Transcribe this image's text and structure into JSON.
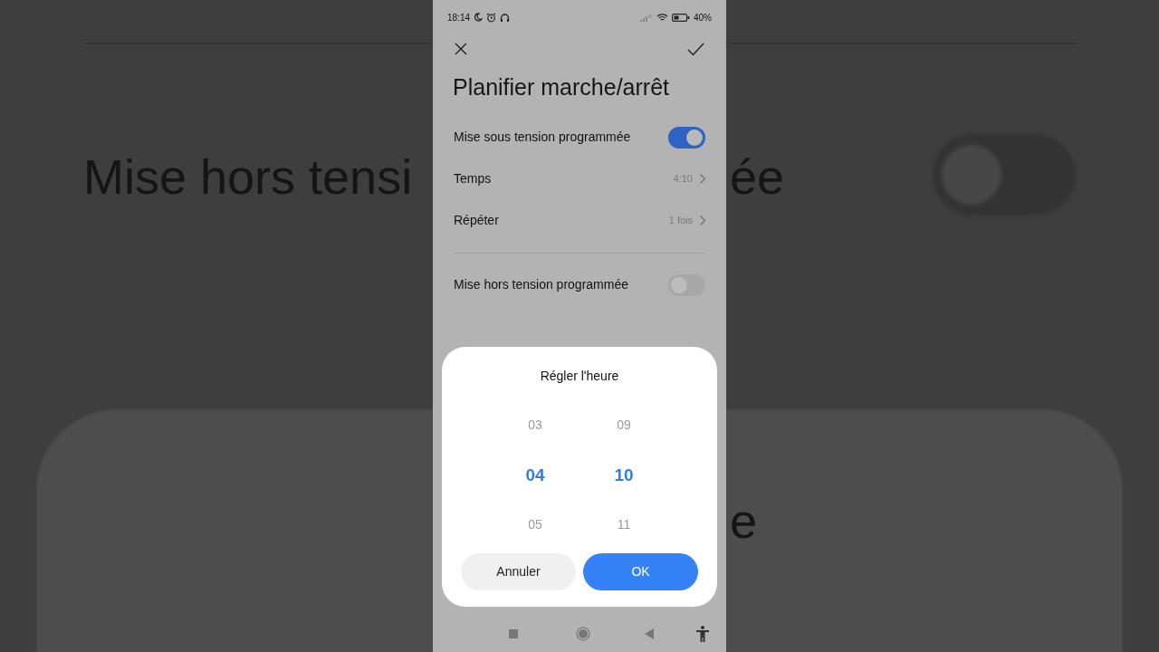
{
  "background": {
    "texts": [
      "Mise hors tensi",
      "ée",
      "e"
    ]
  },
  "status_bar": {
    "time": "18:14",
    "battery": "40%"
  },
  "header": {
    "title": "Planifier marche/arrêt"
  },
  "sections": [
    [
      {
        "kind": "toggle",
        "label": "Mise sous tension programmée",
        "on": true
      },
      {
        "kind": "link",
        "label": "Temps",
        "value": "4:10"
      },
      {
        "kind": "link",
        "label": "Répéter",
        "value": "1 fois"
      }
    ],
    [
      {
        "kind": "toggle",
        "label": "Mise hors tension programmée",
        "on": false
      }
    ]
  ],
  "dialog": {
    "title": "Régler l'heure",
    "columns": [
      {
        "items": [
          {
            "label": "03",
            "selected": false
          },
          {
            "label": "04",
            "selected": true
          },
          {
            "label": "05",
            "selected": false
          }
        ]
      },
      {
        "items": [
          {
            "label": "09",
            "selected": false
          },
          {
            "label": "10",
            "selected": true
          },
          {
            "label": "11",
            "selected": false
          }
        ]
      }
    ],
    "buttons": [
      {
        "label": "Annuler",
        "kind": "secondary"
      },
      {
        "label": "OK",
        "kind": "primary"
      }
    ]
  }
}
